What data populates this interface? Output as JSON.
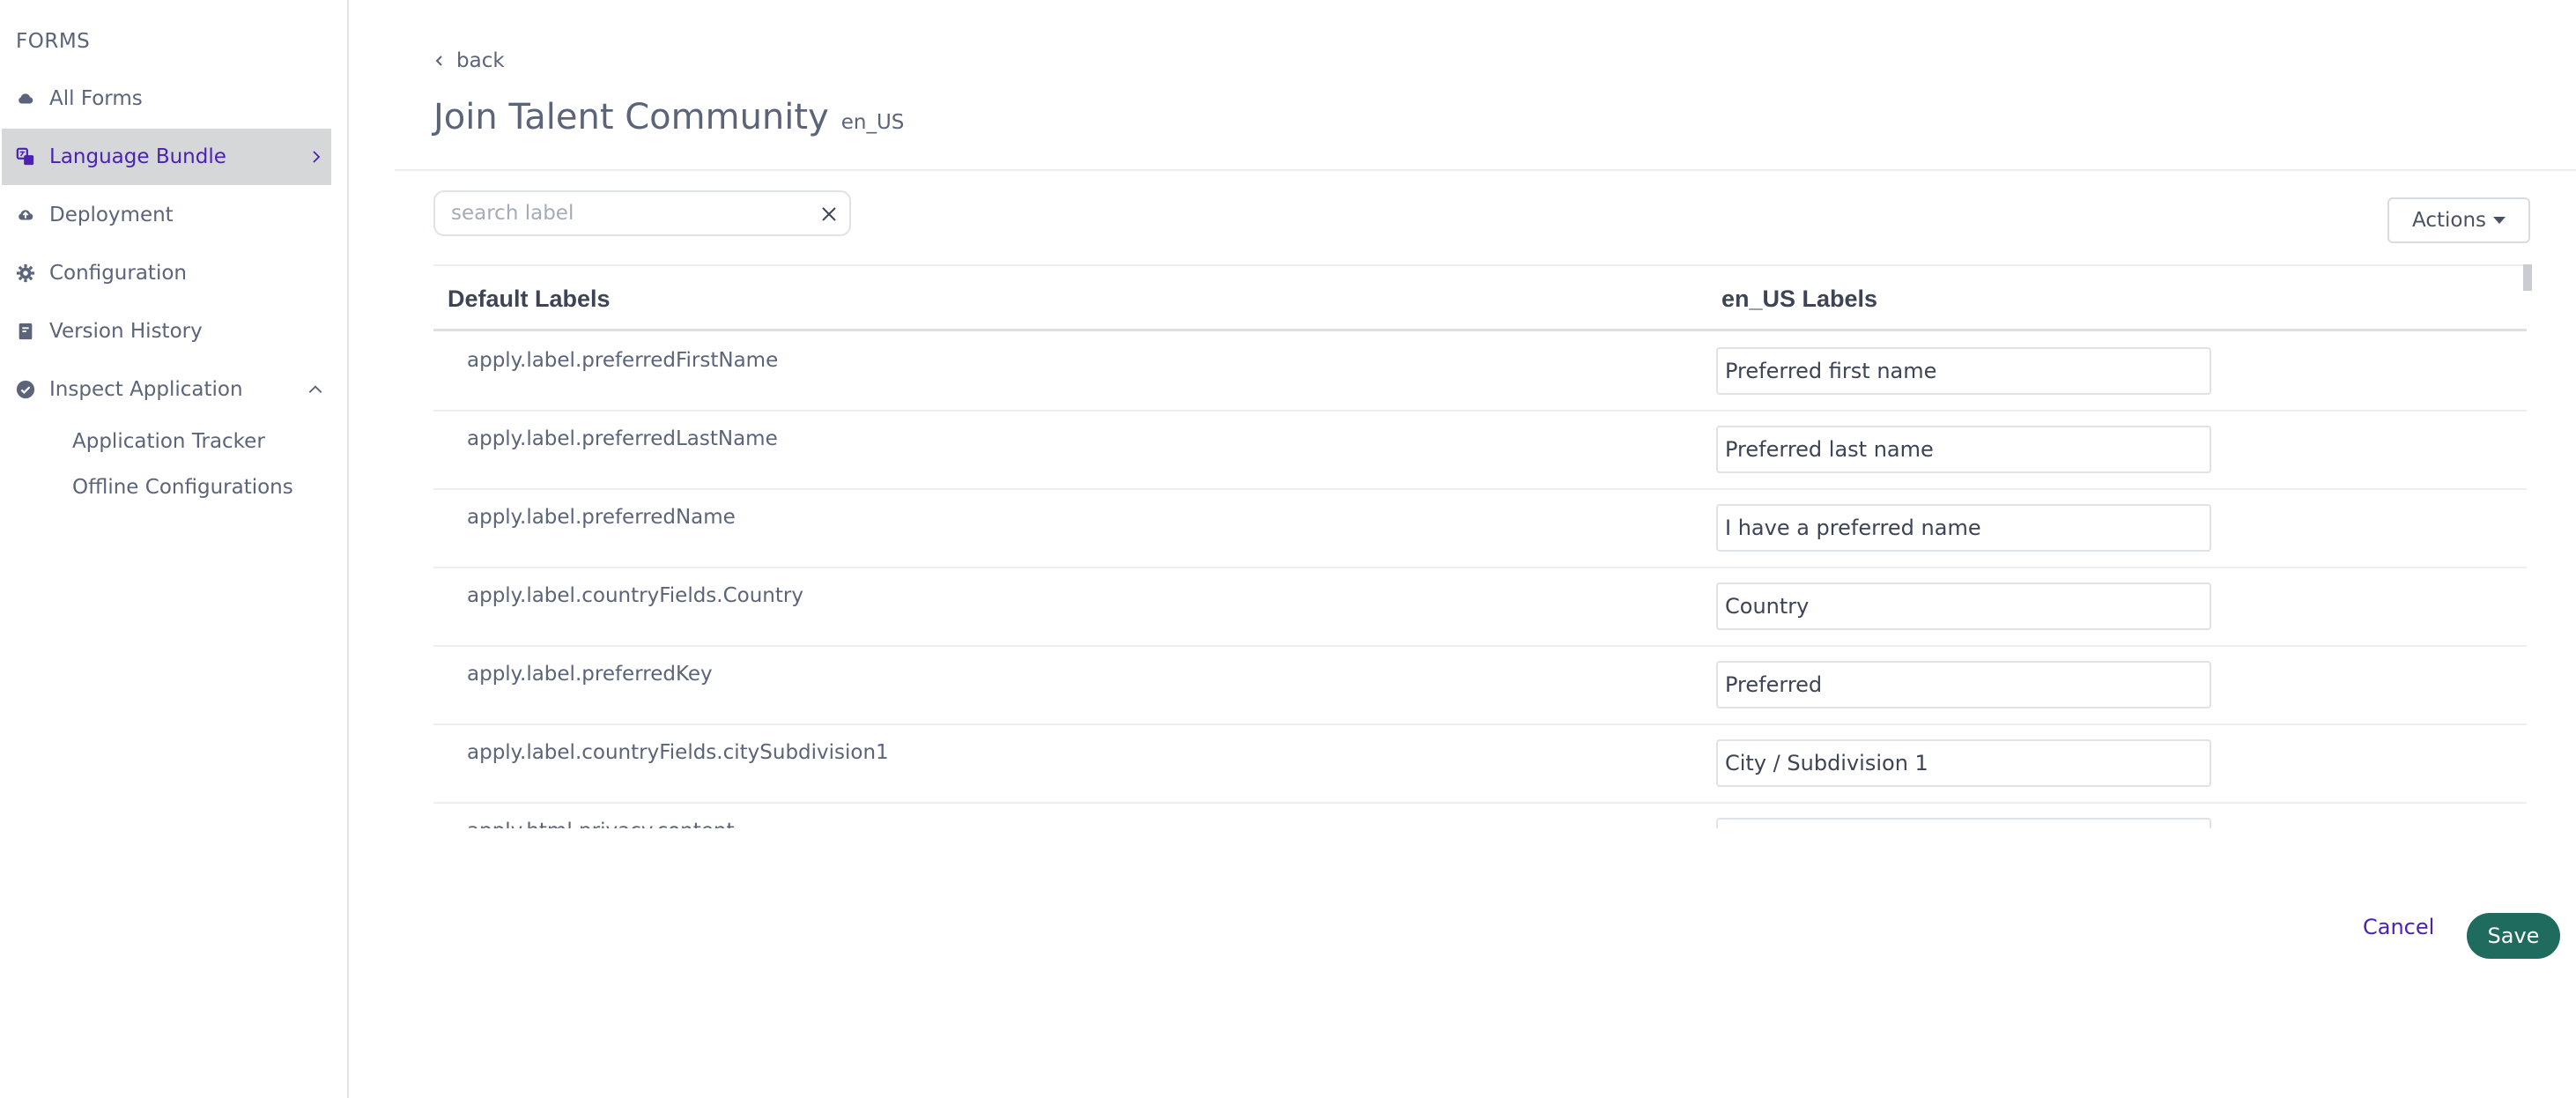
{
  "sidebar": {
    "heading": "FORMS",
    "items": [
      {
        "label": "All Forms",
        "icon": "cloud-icon"
      },
      {
        "label": "Language Bundle",
        "icon": "translate-icon",
        "active": true
      },
      {
        "label": "Deployment",
        "icon": "cloud-upload-icon"
      },
      {
        "label": "Configuration",
        "icon": "gear-icon"
      },
      {
        "label": "Version History",
        "icon": "document-icon"
      },
      {
        "label": "Inspect Application",
        "icon": "check-circle-icon",
        "expanded": true
      }
    ],
    "subitems": [
      {
        "label": "Application Tracker"
      },
      {
        "label": "Offline Configurations"
      }
    ]
  },
  "header": {
    "back_label": "back",
    "title": "Join Talent Community",
    "locale": "en_US"
  },
  "search": {
    "placeholder": "search label",
    "value": ""
  },
  "actions": {
    "label": "Actions"
  },
  "table": {
    "columns": [
      "Default Labels",
      "en_US Labels"
    ],
    "rows": [
      {
        "key": "apply.label.preferredFirstName",
        "value": "Preferred first name"
      },
      {
        "key": "apply.label.preferredLastName",
        "value": "Preferred last name"
      },
      {
        "key": "apply.label.preferredName",
        "value": "I have a preferred name"
      },
      {
        "key": "apply.label.countryFields.Country",
        "value": "Country"
      },
      {
        "key": "apply.label.preferredKey",
        "value": "Preferred"
      },
      {
        "key": "apply.label.countryFields.citySubdivision1",
        "value": "City / Subdivision 1"
      },
      {
        "key": "apply.html.privacy.content",
        "value": ""
      }
    ]
  },
  "footer": {
    "cancel_label": "Cancel",
    "save_label": "Save"
  },
  "colors": {
    "accent": "#4b22b4",
    "save": "#1f6b5e",
    "active_bg": "#d6d7d8",
    "text": "#5b6478"
  }
}
